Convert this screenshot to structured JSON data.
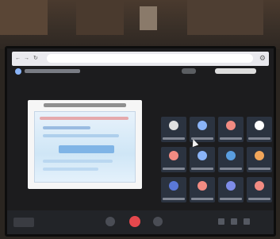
{
  "browser": {
    "back_icon": "back-arrow-icon",
    "forward_icon": "forward-arrow-icon",
    "reload_icon": "reload-icon",
    "settings_icon": "gear-icon"
  },
  "meeting": {
    "participant_count": 12,
    "avatar_colors": [
      "#e0e0e0",
      "#8ab4f8",
      "#f28b82",
      "#ffffff",
      "#f28b82",
      "#8ab4f8",
      "#5a9ee0",
      "#f2a65a",
      "#5a78d8",
      "#f28b82",
      "#7e8ce8",
      "#f28b82"
    ]
  },
  "controls": {
    "end_call_color": "#e5484d"
  }
}
